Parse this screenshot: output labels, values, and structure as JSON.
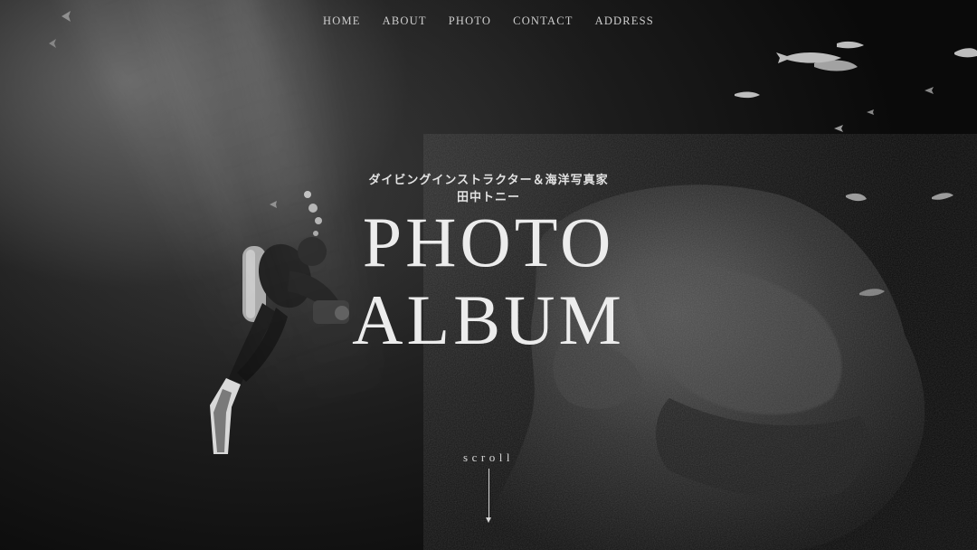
{
  "nav": {
    "items": [
      {
        "label": "HOME"
      },
      {
        "label": "ABOUT"
      },
      {
        "label": "PHOTO"
      },
      {
        "label": "CONTACT"
      },
      {
        "label": "ADDRESS"
      }
    ]
  },
  "hero": {
    "subtitle_line1": "ダイビングインストラクター＆海洋写真家",
    "subtitle_line2": "田中トニー",
    "title_line1": "PHOTO",
    "title_line2": "ALBUM",
    "scroll_label": "scroll",
    "scroll_icon": "arrow-down-icon"
  },
  "background": {
    "photo": "black-and-white underwater photo: scuba diver with camera beside a large reef rock, small fish swimming",
    "tone_light": "#9a9a9a",
    "tone_dark": "#0b0b0b"
  }
}
